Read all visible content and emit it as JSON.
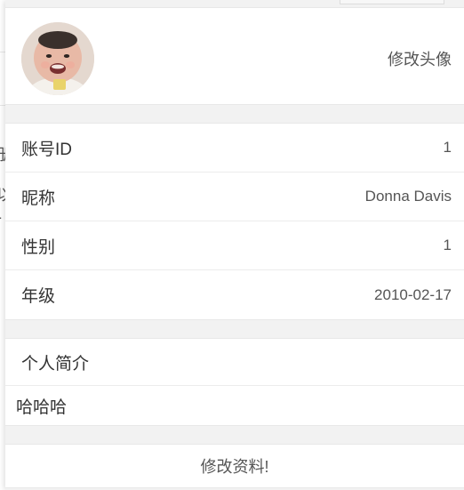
{
  "avatar": {
    "action_label": "修改头像"
  },
  "profile": {
    "rows": [
      {
        "label": "账号ID",
        "value": "1"
      },
      {
        "label": "昵称",
        "value": "Donna Davis"
      },
      {
        "label": "性别",
        "value": "1"
      },
      {
        "label": "年级",
        "value": "2010-02-17"
      }
    ]
  },
  "bio": {
    "title": "个人简介",
    "text": "哈哈哈"
  },
  "edit_button": {
    "label": "修改资料!"
  },
  "background": {
    "glyphs": [
      "册",
      "以",
      "-"
    ]
  }
}
